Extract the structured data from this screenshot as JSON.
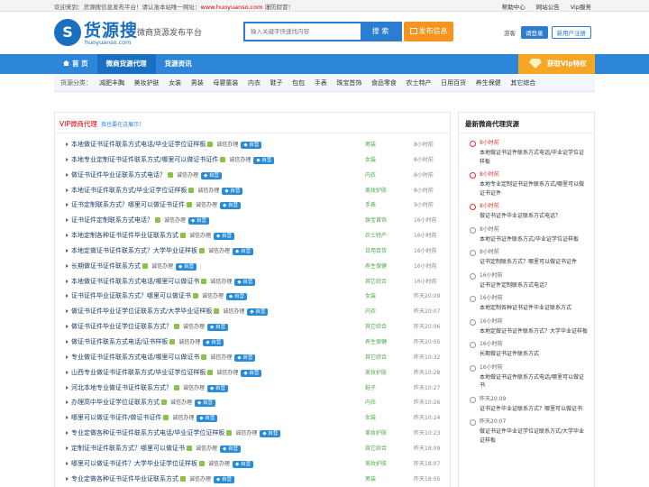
{
  "topbar": {
    "welcome": "欢迎来到：货源搜信息发布平台！请认准本站唯一网址：",
    "site": "www.huoyuanso.com",
    "suffix": " 谨防假冒！",
    "links": [
      "帮助中心",
      "网站公告",
      "Vip服务"
    ]
  },
  "header": {
    "logo_mark": "S",
    "logo_name": "货源搜",
    "logo_domain": "huoyuanso.com",
    "slogan": "微商货源发布平台",
    "search_placeholder": "输入关键字快速找内容",
    "search_button": "搜 索",
    "post_button": "发布信息",
    "guest": "游客",
    "login": "请登录",
    "register": "新用户注册"
  },
  "nav": {
    "items": [
      "首 页",
      "微商货源代理",
      "货源资讯"
    ],
    "active_index": 1,
    "vip": "获取Vip特权"
  },
  "category": {
    "label": "货源分类：",
    "items": [
      "减肥丰胸",
      "美妆护肤",
      "女装",
      "男装",
      "母婴童装",
      "内衣",
      "鞋子",
      "包包",
      "手表",
      "珠宝首饰",
      "食品零食",
      "农士特产",
      "日用百货",
      "养生保健",
      "其它综合"
    ]
  },
  "main": {
    "title": "VIP微商代理",
    "note": "我也要在这展示！",
    "flag": "诚信办理",
    "badge": "自营",
    "rows": [
      {
        "title": "本地做证书证件联系方式电话/毕业证学位证样板",
        "category": "男装",
        "time": "8小时前"
      },
      {
        "title": "本地专业定制证书证件联系方式/哪里可以做证书证件",
        "category": "女装",
        "time": "8小时前"
      },
      {
        "title": "做证书证件毕业证联系方式电话？",
        "category": "内衣",
        "time": "8小时前"
      },
      {
        "title": "本地证书证件联系方式/毕业证学位证样板",
        "category": "美妆护肤",
        "time": "8小时前"
      },
      {
        "title": "证书定制联系方式？哪里可以做证书证件",
        "category": "手表",
        "time": "9小时前"
      },
      {
        "title": "证书证件定制联系方式电话？",
        "category": "珠宝首饰",
        "time": "16小时前"
      },
      {
        "title": "本地定制各种证书证件毕业证联系方式",
        "category": "农士特产",
        "time": "16小时前"
      },
      {
        "title": "本地定做证书证件联系方式？大学毕业证样板",
        "category": "日用百货",
        "time": "16小时前"
      },
      {
        "title": "长期做证书证件联系方式",
        "category": "养生保健",
        "time": "16小时前"
      },
      {
        "title": "本地做证书证件联系方式电话/哪里可以做证书",
        "category": "其它综合",
        "time": "16小时前"
      },
      {
        "title": "证书证件毕业证联系方式？哪里可以做证书",
        "category": "女装",
        "time": "昨天20:09"
      },
      {
        "title": "做证书证件毕业证学位证联系方式/大学毕业证样板",
        "category": "内衣",
        "time": "昨天20:07"
      },
      {
        "title": "做证书证件毕业证学位证联系方式？",
        "category": "其它综合",
        "time": "昨天20:06"
      },
      {
        "title": "做证书证件联系方式电话/证书样板",
        "category": "养生保健",
        "time": "昨天20:05"
      },
      {
        "title": "专业做证书证件联系方式电话/哪里可以做证书",
        "category": "其它综合",
        "time": "昨天10:32"
      },
      {
        "title": "山西专业做证书证件联系方式/毕业证学位证样板",
        "category": "美妆护肤",
        "time": "昨天10:28"
      },
      {
        "title": "河北本地专业做证书证件联系方式？",
        "category": "鞋子",
        "time": "昨天10:27"
      },
      {
        "title": "办理高中毕业证学位证联系方式",
        "category": "内衣",
        "time": "昨天10:26"
      },
      {
        "title": "哪里可以做证书证件/做证书证件",
        "category": "女装",
        "time": "昨天10:24"
      },
      {
        "title": "专业定做各种证书证件联系方式电话/毕业证学位证样板",
        "category": "美妆护肤",
        "time": "昨天10:23"
      },
      {
        "title": "定制证书证件联系方式？哪里可以做证书",
        "category": "其它综合",
        "time": "昨天18:09"
      },
      {
        "title": "哪里可以做证书证件？大学毕业证学位证样板",
        "category": "美妆护肤",
        "time": "昨天18:07"
      },
      {
        "title": "专业定做各种证书证件毕业证联系方式",
        "category": "男装",
        "time": "昨天18:05"
      }
    ]
  },
  "side": {
    "title": "最新微商代理货源",
    "items": [
      {
        "time": "8小时前",
        "text": "本地做证书证件联系方式电话/毕业证学位证样板",
        "red": true
      },
      {
        "time": "8小时前",
        "text": "本地专业定制证书证件联系方式/哪里可以做证书证件",
        "red": true
      },
      {
        "time": "8小时前",
        "text": "做证书证件毕业证联系方式电话？",
        "red": true
      },
      {
        "time": "8小时前",
        "text": "本地证书证件联系方式/毕业证学位证样板",
        "red": false
      },
      {
        "time": "8小时前",
        "text": "证书定制联系方式？哪里可以做证书证件",
        "red": false
      },
      {
        "time": "16小时前",
        "text": "证书证件定制联系方式电话？",
        "red": false
      },
      {
        "time": "16小时前",
        "text": "本地定制各种证书证件毕业证联系方式",
        "red": false
      },
      {
        "time": "16小时前",
        "text": "本地定做证书证件联系方式？大学毕业证样板",
        "red": false
      },
      {
        "time": "16小时前",
        "text": "长期做证书证件联系方式",
        "red": false
      },
      {
        "time": "16小时前",
        "text": "本地做证书证件联系方式电话/哪里可以做证书",
        "red": false
      },
      {
        "time": "昨天20:09",
        "text": "证书证件毕业证联系方式？哪里可以做证书",
        "red": false
      },
      {
        "time": "昨天20:07",
        "text": "做证书证件毕业证学位证联系方式/大学毕业证样板",
        "red": false
      }
    ]
  },
  "colors": {
    "brand": "#1a6fc0",
    "nav": "#2e86d8",
    "accent": "#f7931e",
    "vip": "#f5a623",
    "title_red": "#dd0000"
  }
}
